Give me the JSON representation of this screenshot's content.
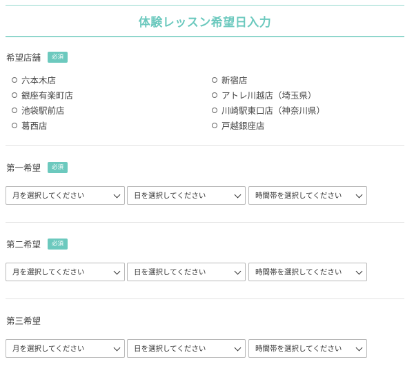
{
  "header": {
    "title": "体験レッスン希望日入力"
  },
  "required_badge": "必須",
  "store_section": {
    "label": "希望店舗",
    "stores": [
      "六本木店",
      "新宿店",
      "銀座有楽町店",
      "アトレ川越店（埼玉県）",
      "池袋駅前店",
      "川崎駅東口店（神奈川県）",
      "葛西店",
      "戸越銀座店"
    ]
  },
  "choices": [
    {
      "label": "第一希望",
      "required": true
    },
    {
      "label": "第二希望",
      "required": true
    },
    {
      "label": "第三希望",
      "required": false
    }
  ],
  "selects": {
    "month_placeholder": "月を選択してください",
    "day_placeholder": "日を選択してください",
    "time_placeholder": "時間帯を選択してください"
  },
  "colors": {
    "accent": "#6cc9be"
  }
}
